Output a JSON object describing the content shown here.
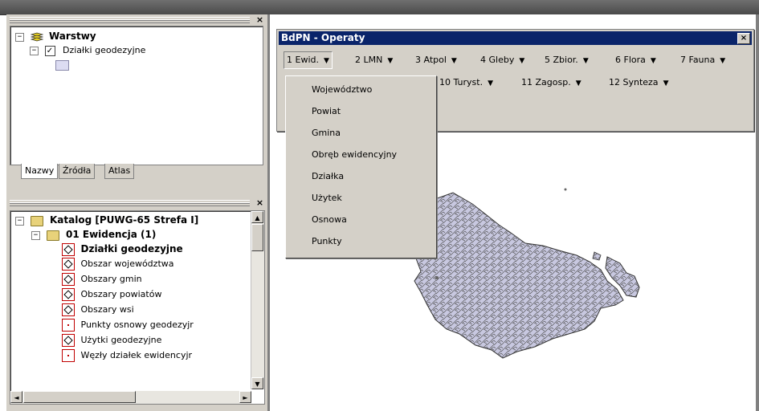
{
  "window": {
    "title": "BdPN - Operaty",
    "close_glyph": "×"
  },
  "layers_panel": {
    "close_glyph": "×",
    "root_label": "Warstwy",
    "root_toggle": "−",
    "layer_label": "Działki geodezyjne",
    "layer_toggle": "−",
    "layer_checked": "✓",
    "swatch_color": "#dcdcf2",
    "tabs": [
      "Nazwy",
      "Źródła",
      "Atlas"
    ]
  },
  "catalog_panel": {
    "close_glyph": "×",
    "root_label": "Katalog [PUWG-65 Strefa I]",
    "root_toggle": "−",
    "folder_label": "01 Ewidencja (1)",
    "folder_toggle": "−",
    "items": [
      {
        "label": "Działki geodezyjne",
        "icon": "polygon-layer-icon",
        "bold": true
      },
      {
        "label": "Obszar województwa",
        "icon": "polygon-layer-icon",
        "bold": false
      },
      {
        "label": "Obszary gmin",
        "icon": "polygon-layer-icon",
        "bold": false
      },
      {
        "label": "Obszary powiatów",
        "icon": "polygon-layer-icon",
        "bold": false
      },
      {
        "label": "Obszary wsi",
        "icon": "polygon-layer-icon",
        "bold": false
      },
      {
        "label": "Punkty osnowy geodezyjr",
        "icon": "point-layer-icon",
        "bold": false
      },
      {
        "label": "Użytki geodezyjne",
        "icon": "polygon-layer-icon",
        "bold": false
      },
      {
        "label": "Węzły działek ewidencyjr",
        "icon": "point-layer-icon",
        "bold": false
      }
    ],
    "scroll_up": "▲",
    "scroll_down": "▼",
    "scroll_left": "◄",
    "scroll_right": "►"
  },
  "menu": {
    "row1": [
      "1 Ewid.",
      "2 LMN",
      "3 Atpol",
      "4 Gleby",
      "5 Zbior.",
      "6 Flora",
      "7 Fauna"
    ],
    "row2": [
      "10 Turyst.",
      "11 Zagosp.",
      "12 Synteza"
    ],
    "arrow": "▼"
  },
  "dropdown": {
    "items": [
      "Województwo",
      "Powiat",
      "Gmina",
      "Obręb ewidencyjny",
      "Działka",
      "Użytek",
      "Osnowa",
      "Punkty"
    ]
  },
  "map": {
    "fill_color": "#c8c8e0",
    "stroke_color": "#444444"
  }
}
